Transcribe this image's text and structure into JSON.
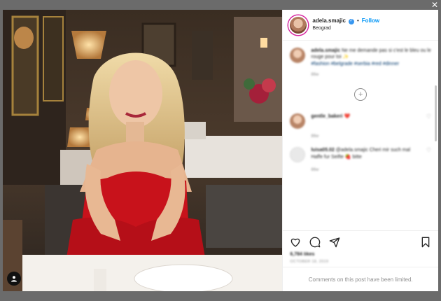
{
  "post": {
    "username": "adela.smajic",
    "follow_label": "Follow",
    "location": "Beograd",
    "caption_user": "adela.smajic",
    "caption_text": "Ne me demande pas si c'est le bleu ou le rouge pour toi ✨",
    "caption_tags": "#fashion #belgrade #serbia #red #dinner",
    "caption_time": "86w",
    "likes": "6,784 likes",
    "date": "OCTOBER 18, 2019",
    "comments_disabled": "Comments on this post have been limited."
  },
  "comments": [
    {
      "user": "gentle_bakeri",
      "text": "❤️",
      "time": "86w"
    },
    {
      "user": "luisa05.02",
      "text": "@adela.smajic Cheri mir such mal Haffe fur Seifte 🍓 bitte",
      "time": "86w"
    }
  ],
  "colors": {
    "accent": "#0095f6",
    "verified": "#3897f0",
    "dress": "#c8121b"
  },
  "icons": [
    "heart-icon",
    "comment-icon",
    "share-icon",
    "bookmark-icon",
    "user-tag-icon",
    "verified-badge-icon",
    "plus-circle-icon"
  ]
}
